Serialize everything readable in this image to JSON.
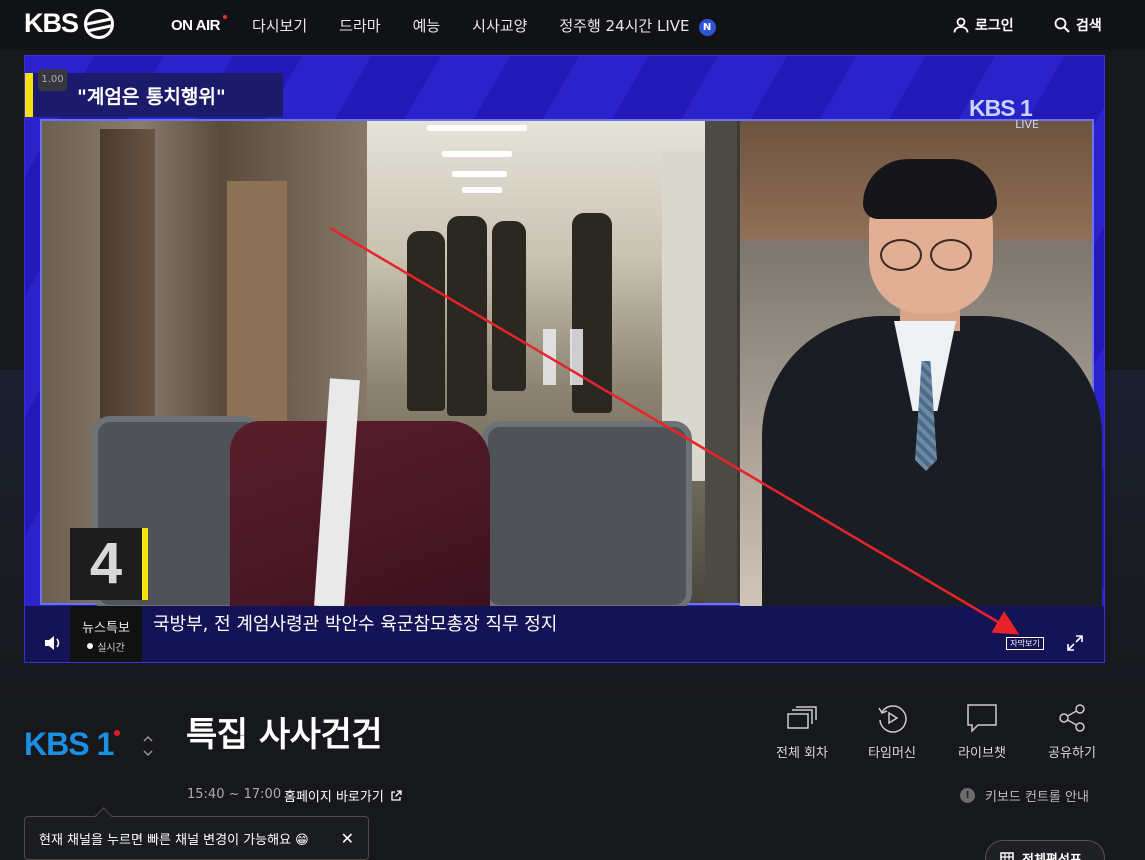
{
  "header": {
    "logo_text": "KBS",
    "nav": [
      {
        "label": "ON AIR",
        "active": true
      },
      {
        "label": "다시보기"
      },
      {
        "label": "드라마"
      },
      {
        "label": "예능"
      },
      {
        "label": "시사교양"
      },
      {
        "label": "정주행 24시간 LIVE",
        "badge": "N"
      }
    ],
    "login_label": "로그인",
    "search_label": "검색"
  },
  "player": {
    "speed_label": "1.00",
    "headline": "\"계엄은 통치행위\"",
    "channel_logo": "KBS 1",
    "channel_live": "LIVE",
    "channel_number": "4",
    "news_label": "뉴스특보",
    "realtime_label": "실시간",
    "ticker": "국방부, 전 계엄사령관 박안수 육군참모총장 직무 정지",
    "caption_button": "자막보기"
  },
  "program": {
    "channel_logo": "KBS 1",
    "title": "특집 사사건건",
    "time": "15:40 ~ 17:00",
    "homepage_link": "홈페이지 바로가기",
    "actions": [
      {
        "label": "전체 회차",
        "icon": "episodes-icon"
      },
      {
        "label": "타임머신",
        "icon": "timemachine-icon"
      },
      {
        "label": "라이브챗",
        "icon": "chat-icon"
      },
      {
        "label": "공유하기",
        "icon": "share-icon"
      }
    ],
    "keyboard_guide": "키보드 컨트롤 안내",
    "schedule_button": "전체편성표"
  },
  "toast": {
    "message": "현재 채널을 누르면 빠른 채널 변경이 가능해요 😁"
  },
  "colors": {
    "accent_blue": "#1a8fe3",
    "news_yellow": "#f5e10d",
    "annotation_red": "#e8232a"
  }
}
